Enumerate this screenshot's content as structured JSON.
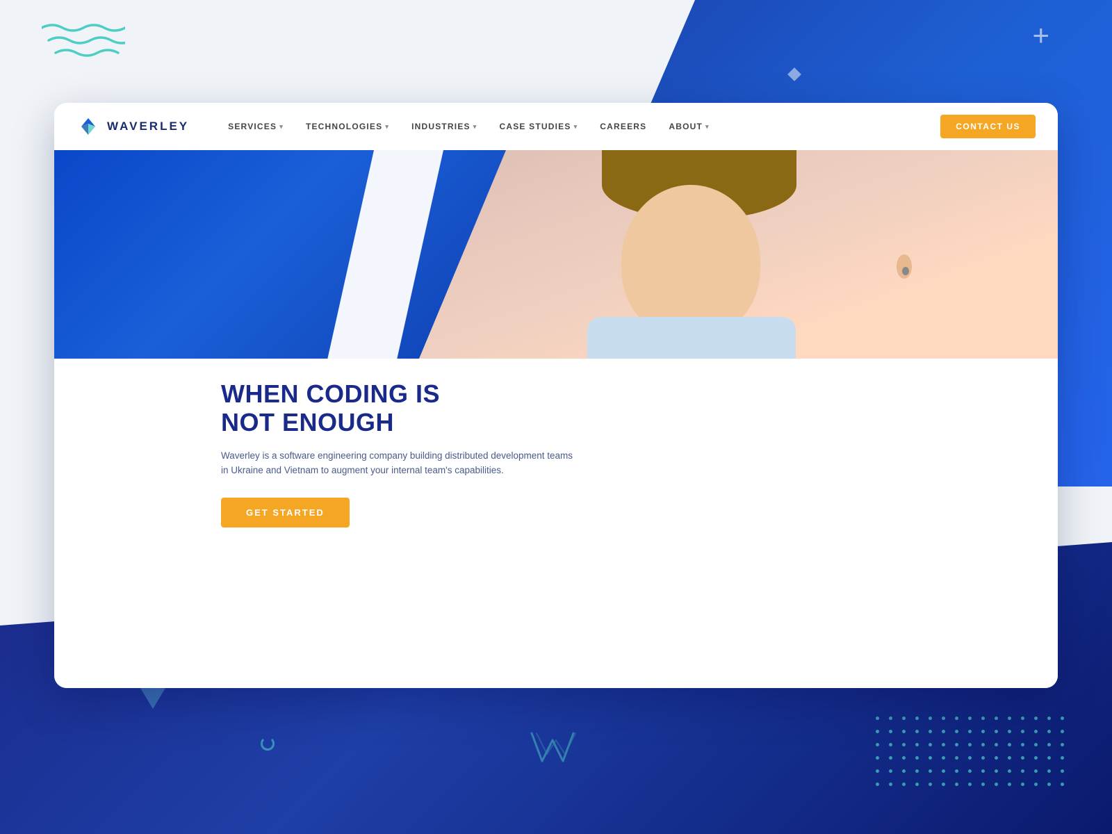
{
  "background": {
    "plus_icon": "+",
    "wave_alt": "decorative wave lines"
  },
  "navbar": {
    "brand_name": "WAVERLEY",
    "nav_items": [
      {
        "label": "SERVICES",
        "has_dropdown": true
      },
      {
        "label": "TECHNOLOGIES",
        "has_dropdown": true
      },
      {
        "label": "INDUSTRIES",
        "has_dropdown": true
      },
      {
        "label": "CASE STUDIES",
        "has_dropdown": true
      },
      {
        "label": "CAREERS",
        "has_dropdown": false
      },
      {
        "label": "ABOUT",
        "has_dropdown": true
      }
    ],
    "contact_button": "CONTACT US"
  },
  "hero": {
    "title_line1": "WHEN CODING IS",
    "title_line2": "NOT ENOUGH",
    "subtitle": "Waverley is a software engineering company building distributed development teams in Ukraine and Vietnam to augment your internal team's capabilities.",
    "cta_label": "GET STARTED"
  },
  "footer_logo": "WAVERLEY",
  "cursor_icon": "☛"
}
